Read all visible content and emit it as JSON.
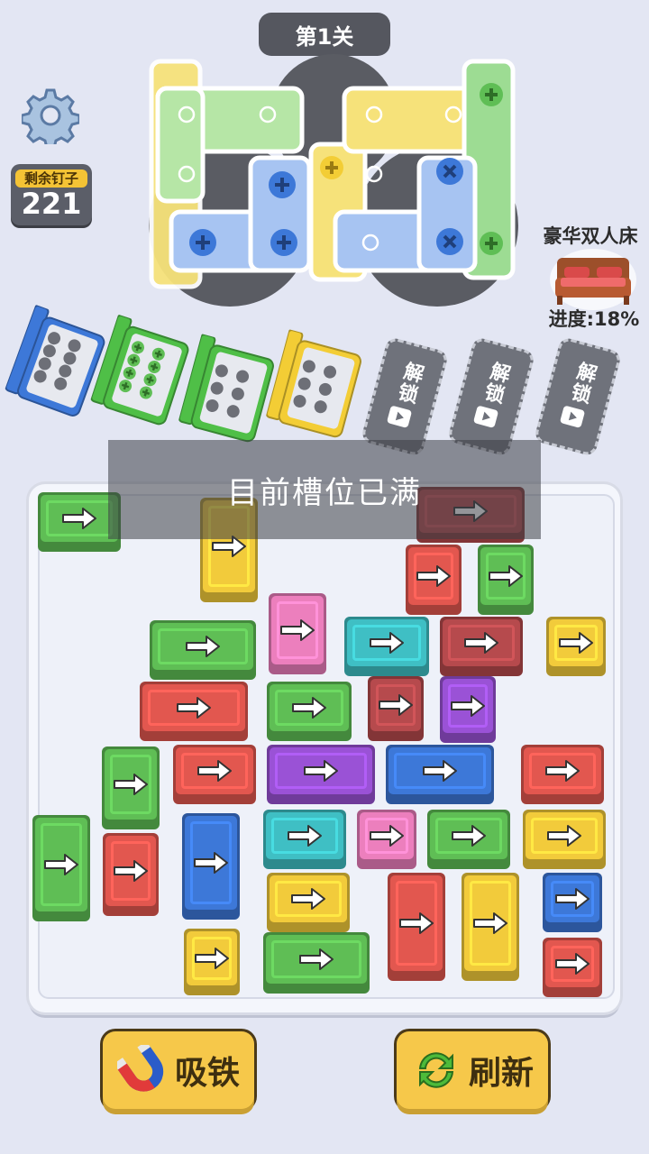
{
  "level": {
    "label": "第1关"
  },
  "screws": {
    "label": "剩余钉子",
    "count": "221"
  },
  "reward": {
    "title": "豪华双人床",
    "progress": "进度:18%"
  },
  "toast": {
    "message": "目前槽位已满"
  },
  "slots": {
    "boxes": [
      {
        "color": "#3d78d8",
        "holes": 8,
        "filled": 0
      },
      {
        "color": "#4fbf47",
        "holes": 8,
        "filled": 8
      },
      {
        "color": "#4fbf47",
        "holes": 6,
        "filled": 0
      },
      {
        "color": "#f3cd35",
        "holes": 6,
        "filled": 0
      }
    ],
    "locked": [
      {
        "label": "解锁"
      },
      {
        "label": "解锁"
      },
      {
        "label": "解锁"
      }
    ]
  },
  "colors": {
    "green": "#5fbe55",
    "yellow": "#f2cb3b",
    "red": "#e2574f",
    "darkred": "#b64a4d",
    "teal": "#3fbfc4",
    "pink": "#ec7fbd",
    "purple": "#9a52d6",
    "blue": "#3d78d8"
  },
  "crates": [
    {
      "color": "green",
      "dir": "left"
    },
    {
      "color": "yellow",
      "dir": "down"
    },
    {
      "color": "darkred",
      "dir": "right"
    },
    {
      "color": "red",
      "dir": "up"
    },
    {
      "color": "green",
      "dir": "up"
    },
    {
      "color": "green",
      "dir": "left"
    },
    {
      "color": "pink",
      "dir": "down"
    },
    {
      "color": "teal",
      "dir": "left"
    },
    {
      "color": "darkred",
      "dir": "left"
    },
    {
      "color": "yellow",
      "dir": "right"
    },
    {
      "color": "red",
      "dir": "left"
    },
    {
      "color": "green",
      "dir": "left"
    },
    {
      "color": "darkred",
      "dir": "up"
    },
    {
      "color": "purple",
      "dir": "up"
    },
    {
      "color": "green",
      "dir": "down"
    },
    {
      "color": "red",
      "dir": "left"
    },
    {
      "color": "purple",
      "dir": "left"
    },
    {
      "color": "blue",
      "dir": "right"
    },
    {
      "color": "red",
      "dir": "right"
    },
    {
      "color": "green",
      "dir": "down"
    },
    {
      "color": "red",
      "dir": "down"
    },
    {
      "color": "blue",
      "dir": "down"
    },
    {
      "color": "teal",
      "dir": "left"
    },
    {
      "color": "pink",
      "dir": "right"
    },
    {
      "color": "green",
      "dir": "right"
    },
    {
      "color": "yellow",
      "dir": "right"
    },
    {
      "color": "yellow",
      "dir": "left"
    },
    {
      "color": "red",
      "dir": "down"
    },
    {
      "color": "yellow",
      "dir": "down"
    },
    {
      "color": "blue",
      "dir": "right"
    },
    {
      "color": "yellow",
      "dir": "down"
    },
    {
      "color": "green",
      "dir": "left"
    },
    {
      "color": "red",
      "dir": "right"
    }
  ],
  "buttons": {
    "magnet": {
      "label": "吸铁",
      "icon": "magnet-icon"
    },
    "refresh": {
      "label": "刷新",
      "icon": "refresh-icon"
    }
  }
}
